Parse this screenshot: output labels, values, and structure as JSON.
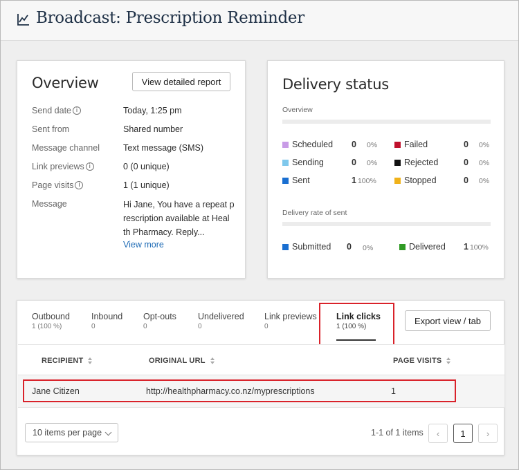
{
  "header": {
    "title": "Broadcast: Prescription Reminder",
    "icon": "line-chart-icon"
  },
  "overview": {
    "title": "Overview",
    "report_button": "View detailed report",
    "rows": [
      {
        "label": "Send date",
        "value": "Today, 1:25 pm",
        "info": true
      },
      {
        "label": "Sent from",
        "value": "Shared number",
        "info": false
      },
      {
        "label": "Message channel",
        "value": "Text message (SMS)",
        "info": false
      },
      {
        "label": "Link previews",
        "value": "0 (0 unique)",
        "info": true
      },
      {
        "label": "Page visits",
        "value": "1 (1 unique)",
        "info": true
      }
    ],
    "message_label": "Message",
    "message_lines": [
      "Hi Jane, You have a repeat p",
      "rescription available at Heal",
      "th Pharmacy. Reply..."
    ],
    "view_more": "View more"
  },
  "delivery": {
    "title": "Delivery status",
    "overview_label": "Overview",
    "statuses": [
      {
        "label": "Scheduled",
        "count": "0",
        "pct": "0%",
        "color": "#c89be6"
      },
      {
        "label": "Failed",
        "count": "0",
        "pct": "0%",
        "color": "#c0102c"
      },
      {
        "label": "Sending",
        "count": "0",
        "pct": "0%",
        "color": "#7fc8ec"
      },
      {
        "label": "Rejected",
        "count": "0",
        "pct": "0%",
        "color": "#111111"
      },
      {
        "label": "Sent",
        "count": "1",
        "pct": "100%",
        "color": "#1a6fd1"
      },
      {
        "label": "Stopped",
        "count": "0",
        "pct": "0%",
        "color": "#f0b21a"
      }
    ],
    "rate_label": "Delivery rate of sent",
    "rates": [
      {
        "label": "Submitted",
        "count": "0",
        "pct": "0%",
        "color": "#1a6fd1"
      },
      {
        "label": "Delivered",
        "count": "1",
        "pct": "100%",
        "color": "#2f9a24"
      }
    ]
  },
  "tabs": [
    {
      "label": "Outbound",
      "count": "1 (100 %)"
    },
    {
      "label": "Inbound",
      "count": "0"
    },
    {
      "label": "Opt-outs",
      "count": "0"
    },
    {
      "label": "Undelivered",
      "count": "0"
    },
    {
      "label": "Link previews",
      "count": "0"
    },
    {
      "label": "Link clicks",
      "count": "1 (100 %)",
      "active": true
    }
  ],
  "export_button": "Export view / tab",
  "table": {
    "columns": [
      "RECIPIENT",
      "ORIGINAL URL",
      "PAGE VISITS"
    ],
    "rows": [
      {
        "recipient": "Jane Citizen",
        "url": "http://healthpharmacy.co.nz/myprescriptions",
        "visits": "1"
      }
    ]
  },
  "pagination": {
    "per_page": "10 items per page",
    "info": "1-1 of 1 items",
    "current_page": "1",
    "prev": "‹",
    "next": "›"
  }
}
